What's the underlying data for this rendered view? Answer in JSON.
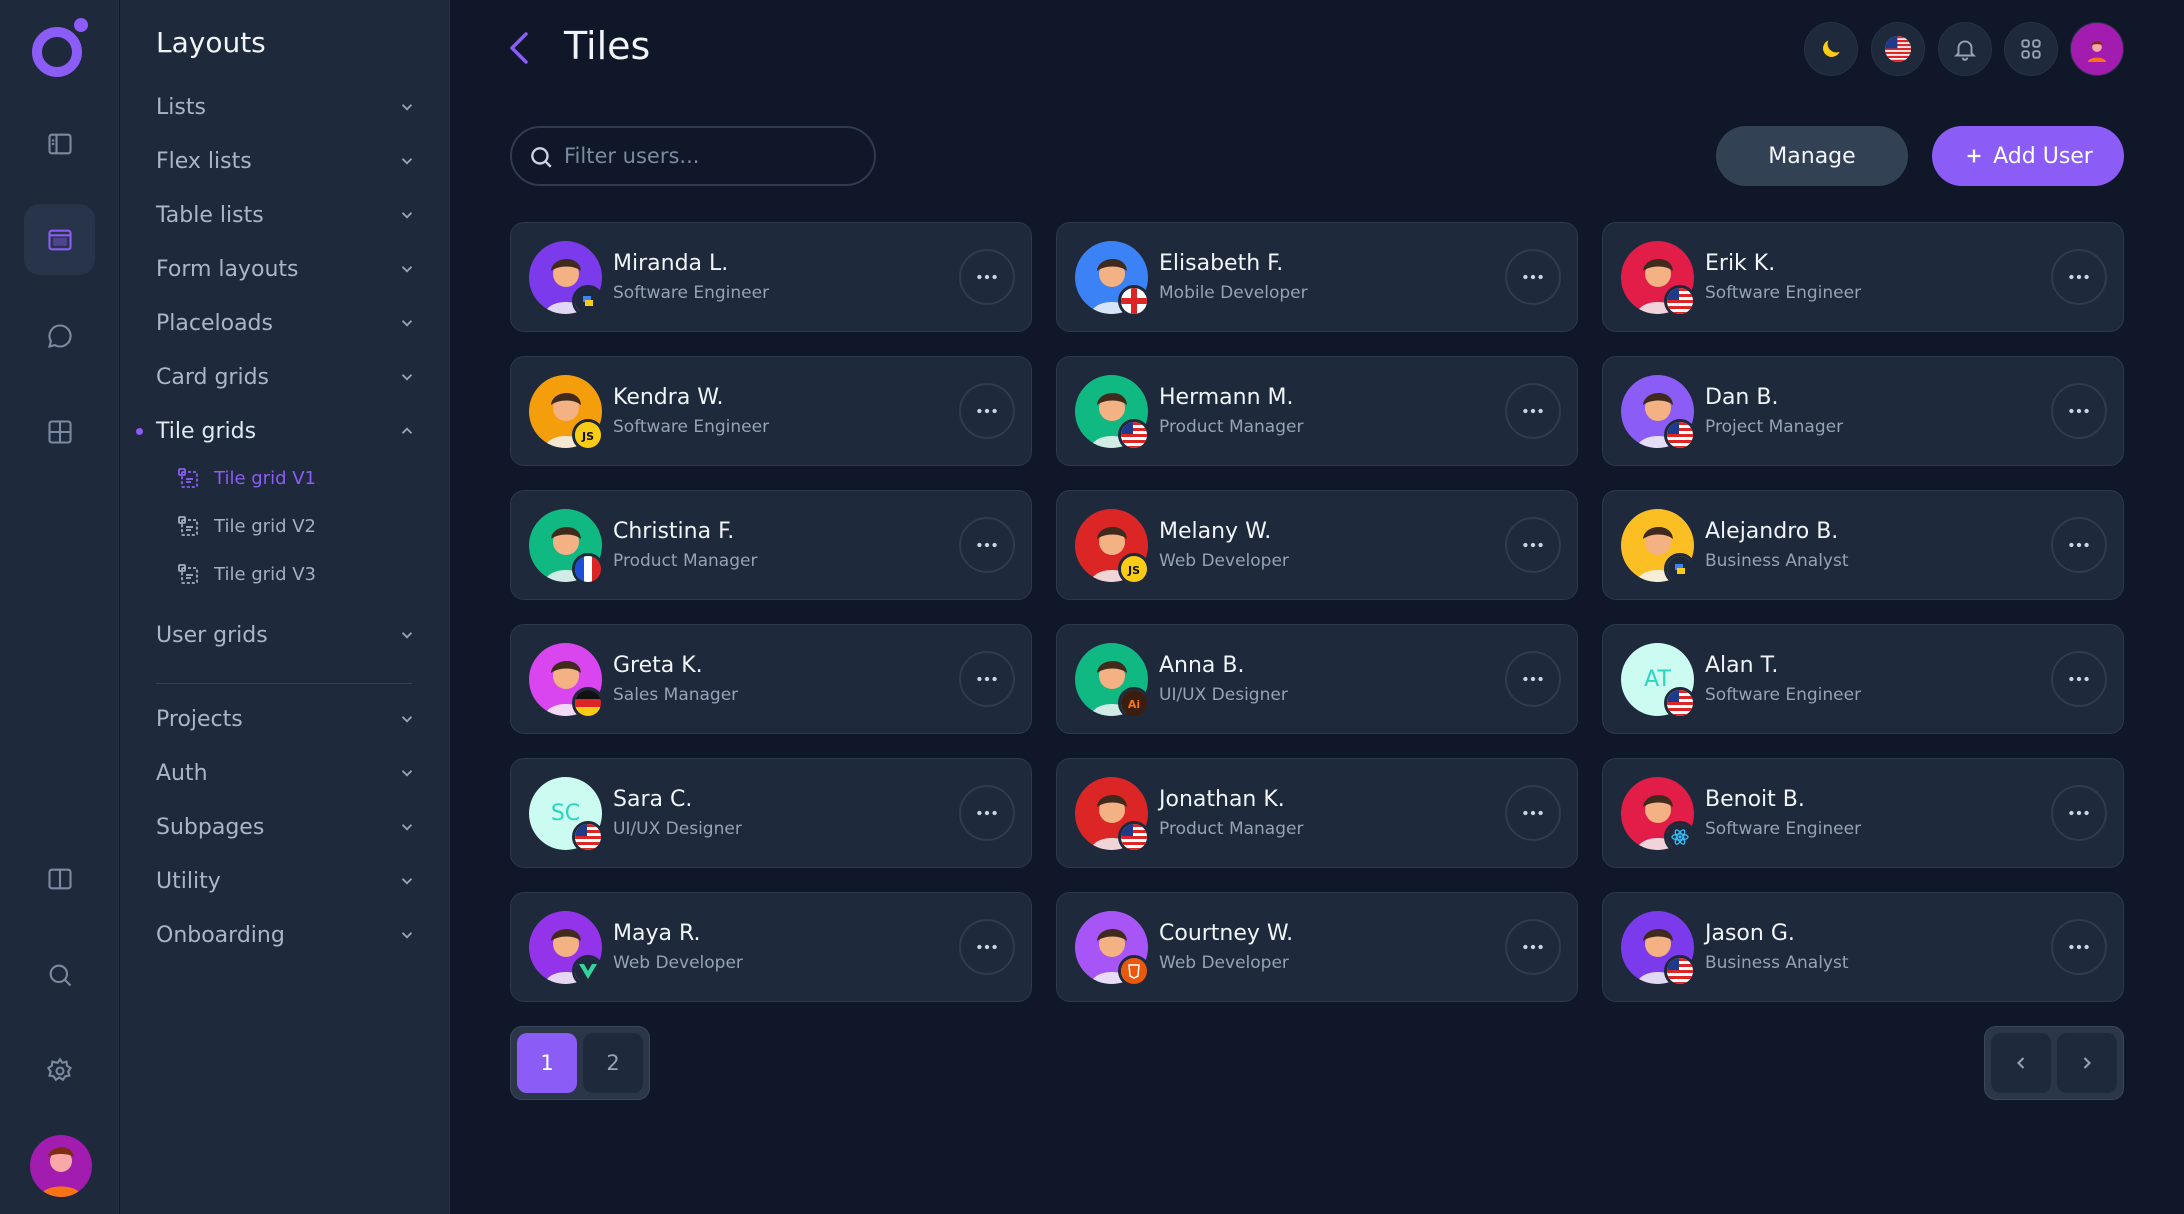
{
  "colors": {
    "accent": "#8b5cf6",
    "bg": "#0f1729",
    "panel": "#1e293b"
  },
  "rail": {
    "items": [
      {
        "name": "sidebar-icon"
      },
      {
        "name": "layout-icon"
      },
      {
        "name": "chat-icon"
      },
      {
        "name": "grid-icon"
      },
      {
        "name": "book-icon"
      },
      {
        "name": "search-icon"
      },
      {
        "name": "settings-icon"
      }
    ]
  },
  "submenu": {
    "title": "Layouts",
    "items": [
      {
        "label": "Lists"
      },
      {
        "label": "Flex lists"
      },
      {
        "label": "Table lists"
      },
      {
        "label": "Form layouts"
      },
      {
        "label": "Placeloads"
      },
      {
        "label": "Card grids"
      },
      {
        "label": "Tile grids"
      },
      {
        "label": "User grids"
      },
      {
        "label": "Projects"
      },
      {
        "label": "Auth"
      },
      {
        "label": "Subpages"
      },
      {
        "label": "Utility"
      },
      {
        "label": "Onboarding"
      }
    ],
    "sub_items": [
      {
        "label": "Tile grid V1"
      },
      {
        "label": "Tile grid V2"
      },
      {
        "label": "Tile grid V3"
      }
    ]
  },
  "header": {
    "title": "Tiles"
  },
  "toolbar": {
    "search_placeholder": "Filter users...",
    "manage_label": "Manage",
    "add_label": "Add User"
  },
  "users": [
    {
      "name": "Miranda L.",
      "role": "Software Engineer",
      "initials": "",
      "bg": "#7c3aed",
      "badge": "python"
    },
    {
      "name": "Elisabeth F.",
      "role": "Mobile Developer",
      "initials": "",
      "bg": "#3b82f6",
      "badge": "uk"
    },
    {
      "name": "Erik K.",
      "role": "Software Engineer",
      "initials": "",
      "bg": "#e11d48",
      "badge": "us"
    },
    {
      "name": "Kendra W.",
      "role": "Software Engineer",
      "initials": "",
      "bg": "#f59e0b",
      "badge": "js"
    },
    {
      "name": "Hermann M.",
      "role": "Product Manager",
      "initials": "",
      "bg": "#10b981",
      "badge": "us"
    },
    {
      "name": "Dan B.",
      "role": "Project Manager",
      "initials": "",
      "bg": "#8b5cf6",
      "badge": "us"
    },
    {
      "name": "Christina F.",
      "role": "Product Manager",
      "initials": "",
      "bg": "#10b981",
      "badge": "fr"
    },
    {
      "name": "Melany W.",
      "role": "Web Developer",
      "initials": "",
      "bg": "#dc2626",
      "badge": "js"
    },
    {
      "name": "Alejandro B.",
      "role": "Business Analyst",
      "initials": "",
      "bg": "#fbbf24",
      "badge": "python"
    },
    {
      "name": "Greta K.",
      "role": "Sales Manager",
      "initials": "",
      "bg": "#d946ef",
      "badge": "de"
    },
    {
      "name": "Anna B.",
      "role": "UI/UX Designer",
      "initials": "",
      "bg": "#10b981",
      "badge": "ai"
    },
    {
      "name": "Alan T.",
      "role": "Software Engineer",
      "initials": "AT",
      "bg": "#ccfbf1",
      "badge": "us"
    },
    {
      "name": "Sara C.",
      "role": "UI/UX Designer",
      "initials": "SC",
      "bg": "#ccfbf1",
      "badge": "us"
    },
    {
      "name": "Jonathan K.",
      "role": "Product Manager",
      "initials": "",
      "bg": "#dc2626",
      "badge": "us"
    },
    {
      "name": "Benoit B.",
      "role": "Software Engineer",
      "initials": "",
      "bg": "#e11d48",
      "badge": "react"
    },
    {
      "name": "Maya R.",
      "role": "Web Developer",
      "initials": "",
      "bg": "#9333ea",
      "badge": "vue"
    },
    {
      "name": "Courtney W.",
      "role": "Web Developer",
      "initials": "",
      "bg": "#a855f7",
      "badge": "html"
    },
    {
      "name": "Jason G.",
      "role": "Business Analyst",
      "initials": "",
      "bg": "#7c3aed",
      "badge": "us"
    }
  ],
  "pagination": {
    "pages": [
      "1",
      "2"
    ],
    "current": "1"
  }
}
